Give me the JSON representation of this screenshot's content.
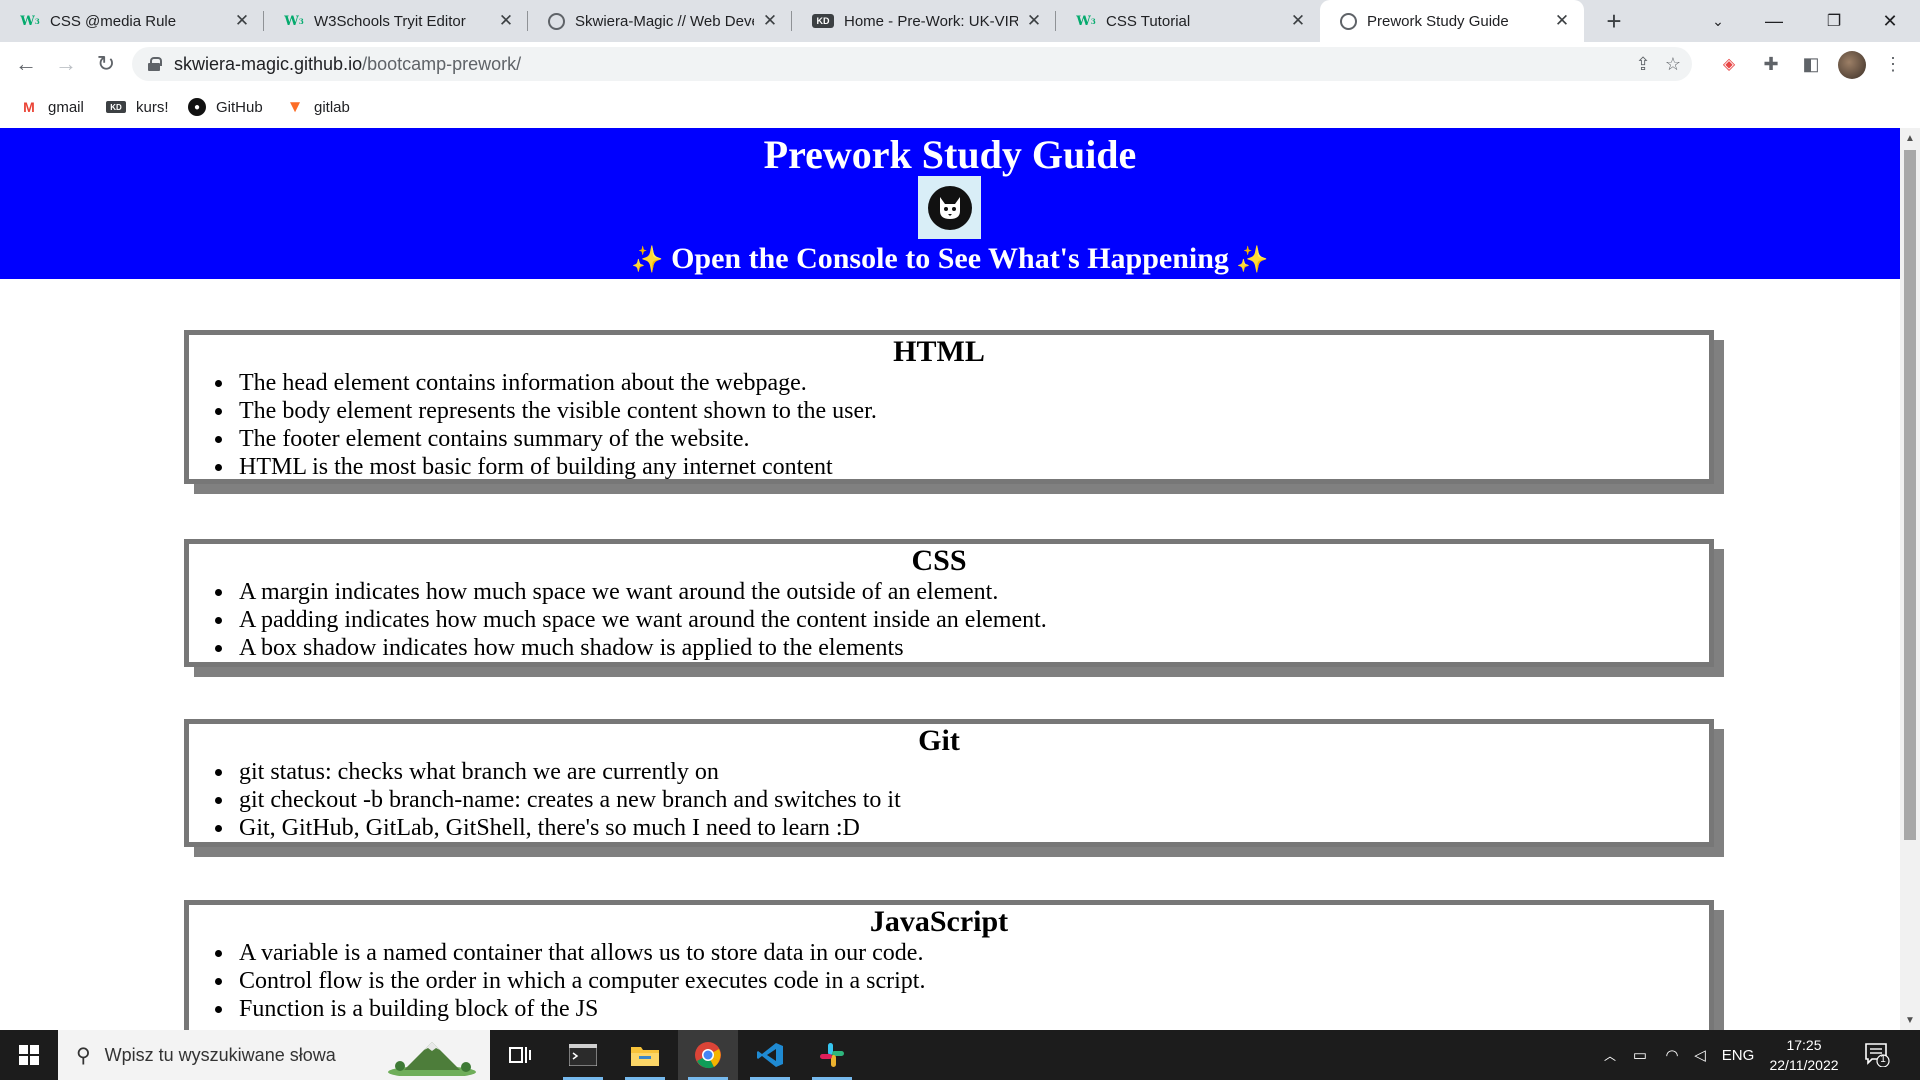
{
  "browser": {
    "tabs": [
      {
        "title": "CSS @media Rule",
        "favicon": "w3schools-icon",
        "active": false
      },
      {
        "title": "W3Schools Tryit Editor",
        "favicon": "w3schools-icon",
        "active": false
      },
      {
        "title": "Skwiera-Magic // Web Deve",
        "favicon": "globe-icon",
        "active": false
      },
      {
        "title": "Home - Pre-Work: UK-VIRT",
        "favicon": "kodilla-icon",
        "active": false
      },
      {
        "title": "CSS Tutorial",
        "favicon": "w3schools-icon",
        "active": false
      },
      {
        "title": "Prework Study Guide",
        "favicon": "globe-icon",
        "active": true
      }
    ],
    "address": {
      "domain": "skwiera-magic.github.io",
      "path": "/bootcamp-prework/"
    },
    "bookmarks": [
      {
        "label": "gmail",
        "icon": "gmail-icon"
      },
      {
        "label": "kurs!",
        "icon": "kodilla-icon"
      },
      {
        "label": "GitHub",
        "icon": "github-icon"
      },
      {
        "label": "gitlab",
        "icon": "gitlab-icon"
      }
    ]
  },
  "page": {
    "title": "Prework Study Guide",
    "subtitle": "Open the Console to See What's Happening",
    "sparkle": "✨",
    "sections": [
      {
        "heading": "HTML",
        "items": [
          "The head element contains information about the webpage.",
          "The body element represents the visible content shown to the user.",
          "The footer element contains summary of the website.",
          "HTML is the most basic form of building any internet content"
        ]
      },
      {
        "heading": "CSS",
        "items": [
          "A margin indicates how much space we want around the outside of an element.",
          "A padding indicates how much space we want around the content inside an element.",
          "A box shadow indicates how much shadow is applied to the elements"
        ]
      },
      {
        "heading": "Git",
        "items": [
          "git status: checks what branch we are currently on",
          "git checkout -b branch-name: creates a new branch and switches to it",
          "Git, GitHub, GitLab, GitShell, there's so much I need to learn :D"
        ]
      },
      {
        "heading": "JavaScript",
        "items": [
          "A variable is a named container that allows us to store data in our code.",
          "Control flow is the order in which a computer executes code in a script.",
          "Function is a building block of the JS"
        ]
      }
    ]
  },
  "taskbar": {
    "search_placeholder": "Wpisz tu wyszukiwane słowa",
    "language": "ENG",
    "time": "17:25",
    "date": "22/11/2022",
    "notification_count": "1"
  },
  "colors": {
    "header_bg": "#0000ff",
    "card_border": "#777777",
    "card_shadow": "#808080"
  }
}
